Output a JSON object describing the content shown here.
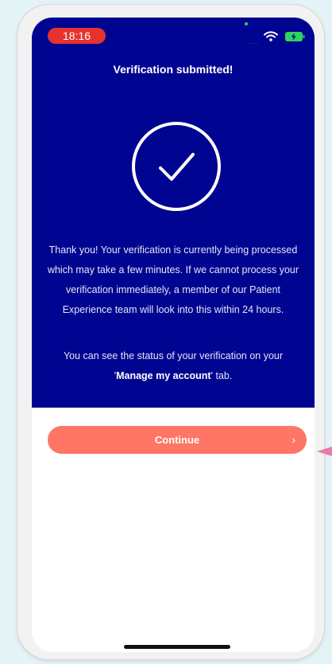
{
  "status_bar": {
    "time": "18:16",
    "signal": "····"
  },
  "title": "Verification submitted!",
  "message": "Thank you! Your verification is currently being processed which may take a few minutes. If we cannot process your verification immediately, a member of our Patient Experience team will look into this within 24 hours.",
  "status_note": {
    "before": "You can see the status of your verification on your '",
    "link": "Manage my account",
    "after": "' tab."
  },
  "continue_button": {
    "label": "Continue",
    "chevron": "›"
  },
  "icons": [
    "check-circle-icon",
    "wifi-icon",
    "battery-charging-icon",
    "chevron-right-icon",
    "pointer-arrow-icon"
  ],
  "colors": {
    "panel": "#000591",
    "button": "#ff7566",
    "time_pill": "#e8322e",
    "page_background": "#e3f3f6",
    "pointer_arrow": "#e87aa6"
  }
}
